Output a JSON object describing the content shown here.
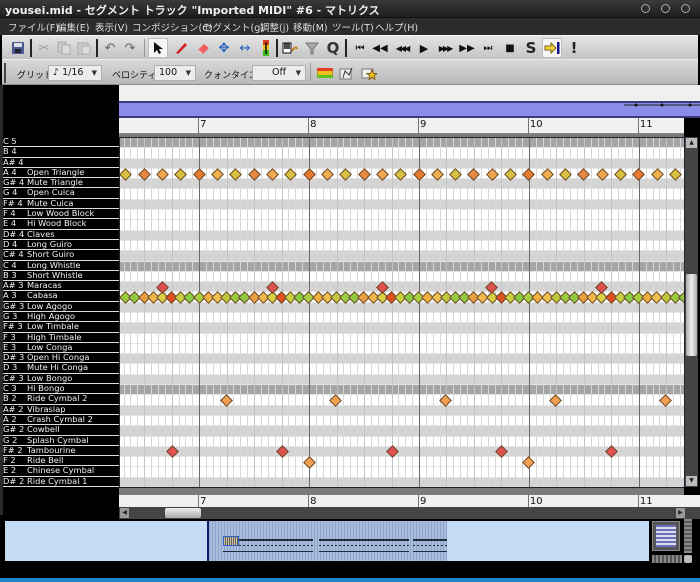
{
  "window": {
    "title": "yousei.mid - セグメント トラック \"Imported MIDI\" #6 - マトリクス"
  },
  "menu": [
    {
      "label": "ファイル(F)"
    },
    {
      "label": "編集(E)"
    },
    {
      "label": "表示(V)"
    },
    {
      "label": "コンポジション(C)"
    },
    {
      "label": "セグメント(g)"
    },
    {
      "label": "調整(j)"
    },
    {
      "label": "移動(M)"
    },
    {
      "label": "ツール(T)"
    },
    {
      "label": "ヘルプ(H)"
    }
  ],
  "toolbar": {
    "edit_tools": [
      "save-icon",
      "cut-icon",
      "copy-icon",
      "paste-icon",
      "undo-icon",
      "redo-icon"
    ],
    "draw_tools": [
      "select-icon",
      "pencil-icon",
      "eraser-icon",
      "move-icon",
      "resize-icon",
      "velocity-icon"
    ],
    "misc_tools": [
      "chord-icon",
      "filter-icon",
      "quantize-icon"
    ],
    "quantize_glyph": "Q",
    "transport": [
      "rewind-start-icon",
      "rewind-icon",
      "fast-rewind-icon",
      "play-icon",
      "fast-forward-icon",
      "forward-icon",
      "forward-end-icon",
      "stop-icon",
      "solo-icon",
      "scroll-follow-icon",
      "panic-icon"
    ],
    "solo_glyph": "S",
    "panic_glyph": "!"
  },
  "options": {
    "grid_label": "グリッド:",
    "grid_value": "1/16",
    "velocity_label": "ベロシティ:",
    "velocity_value": "100",
    "quantize_label": "クォンタイズ:",
    "quantize_value": "Off"
  },
  "ruler": {
    "bars": [
      "7",
      "8",
      "9",
      "10",
      "11"
    ],
    "first_bar_number": 7
  },
  "keys": [
    {
      "pitch": "C 5",
      "name": "",
      "type": "c"
    },
    {
      "pitch": "B 4",
      "name": "",
      "type": "white"
    },
    {
      "pitch": "A# 4",
      "name": "",
      "type": "black"
    },
    {
      "pitch": "A 4",
      "name": "Open Triangle",
      "type": "white"
    },
    {
      "pitch": "G# 4",
      "name": "Mute Triangle",
      "type": "black"
    },
    {
      "pitch": "G 4",
      "name": "Open Cuica",
      "type": "white"
    },
    {
      "pitch": "F# 4",
      "name": "Mute Cuica",
      "type": "black"
    },
    {
      "pitch": "F 4",
      "name": "Low Wood Block",
      "type": "white"
    },
    {
      "pitch": "E 4",
      "name": "Hi Wood Block",
      "type": "white"
    },
    {
      "pitch": "D# 4",
      "name": "Claves",
      "type": "black"
    },
    {
      "pitch": "D 4",
      "name": "Long Guiro",
      "type": "white"
    },
    {
      "pitch": "C# 4",
      "name": "Short Guiro",
      "type": "black"
    },
    {
      "pitch": "C 4",
      "name": "Long Whistle",
      "type": "c"
    },
    {
      "pitch": "B 3",
      "name": "Short Whistle",
      "type": "white"
    },
    {
      "pitch": "A# 3",
      "name": "Maracas",
      "type": "black"
    },
    {
      "pitch": "A 3",
      "name": "Cabasa",
      "type": "white"
    },
    {
      "pitch": "G# 3",
      "name": "Low Agogo",
      "type": "black"
    },
    {
      "pitch": "G 3",
      "name": "High Agogo",
      "type": "white"
    },
    {
      "pitch": "F# 3",
      "name": "Low Timbale",
      "type": "black"
    },
    {
      "pitch": "F 3",
      "name": "High Timbale",
      "type": "white"
    },
    {
      "pitch": "E 3",
      "name": "Low Conga",
      "type": "white"
    },
    {
      "pitch": "D# 3",
      "name": "Open Hi Conga",
      "type": "black"
    },
    {
      "pitch": "D 3",
      "name": "Mute Hi Conga",
      "type": "white"
    },
    {
      "pitch": "C# 3",
      "name": "Low Bongo",
      "type": "black"
    },
    {
      "pitch": "C 3",
      "name": "Hi Bongo",
      "type": "c"
    },
    {
      "pitch": "B 2",
      "name": "Ride Cymbal 2",
      "type": "white"
    },
    {
      "pitch": "A# 2",
      "name": "Vibraslap",
      "type": "black"
    },
    {
      "pitch": "A 2",
      "name": "Crash Cymbal 2",
      "type": "white"
    },
    {
      "pitch": "G# 2",
      "name": "Cowbell",
      "type": "black"
    },
    {
      "pitch": "G 2",
      "name": "Splash Cymbal",
      "type": "white"
    },
    {
      "pitch": "F# 2",
      "name": "Tambourine",
      "type": "black"
    },
    {
      "pitch": "F 2",
      "name": "Ride Bell",
      "type": "white"
    },
    {
      "pitch": "E 2",
      "name": "Chinese Cymbal",
      "type": "white"
    },
    {
      "pitch": "D# 2",
      "name": "Ride Cymbal 1",
      "type": "black"
    }
  ],
  "view": {
    "visible_start_bar": 6.28,
    "visible_end_bar": 11.42
  },
  "notes": [
    {
      "row": 3,
      "start": 6.333,
      "end": 11.5,
      "step": 0.1667,
      "colors": [
        "#d8c040",
        "#e88840",
        "#f0a850",
        "#d8c040",
        "#e87a30",
        "#f0b050"
      ]
    },
    {
      "row": 15,
      "start": 6.333,
      "end": 11.5,
      "step": 0.0833,
      "colors": [
        "#9acc40",
        "#90c840",
        "#e8a040",
        "#f0b848",
        "#d8d040",
        "#e05020",
        "#c8d040",
        "#88cc40",
        "#a8d040",
        "#f0b040",
        "#f0c050",
        "#c0c840"
      ]
    },
    {
      "row": 14,
      "start": 6.664,
      "end": 11.5,
      "step": 1,
      "colors": [
        "#e05050"
      ]
    },
    {
      "row": 25,
      "start": 7.245,
      "end": 11.5,
      "step": 1,
      "colors": [
        "#f0a050"
      ]
    },
    {
      "row": 30,
      "start": 6.755,
      "end": 11.5,
      "step": 1,
      "colors": [
        "#e05050"
      ]
    },
    {
      "row": 31,
      "start": 8.0,
      "end": 11.5,
      "step": 2,
      "colors": [
        "#f0a050"
      ]
    }
  ]
}
